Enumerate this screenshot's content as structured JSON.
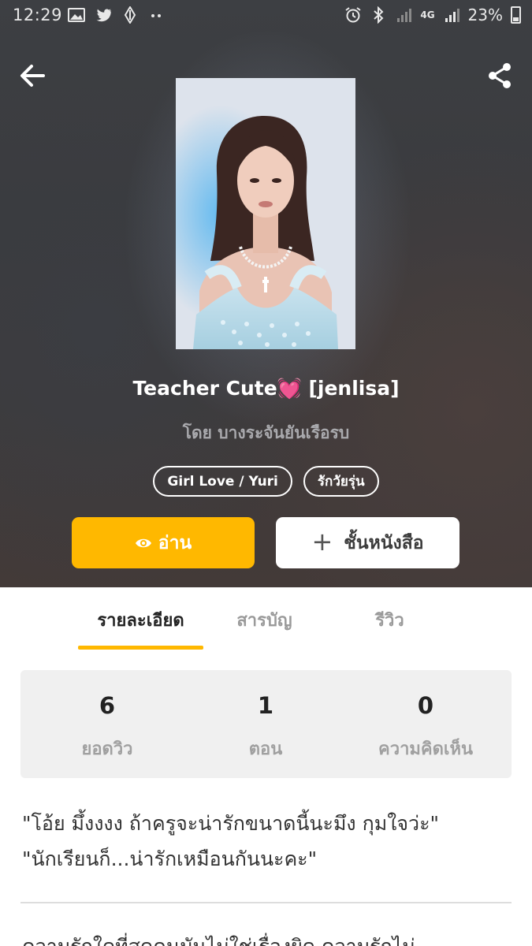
{
  "status_bar": {
    "time": "12:29",
    "network": "4G",
    "battery": "23%"
  },
  "header": {
    "back_icon": "arrow-left-icon",
    "share_icon": "share-icon"
  },
  "book": {
    "title": "Teacher Cute💓 [jenlisa]",
    "author": "โดย บางระจันยันเรือรบ",
    "tags": [
      "Girl Love / Yuri",
      "รักวัยรุ่น"
    ]
  },
  "actions": {
    "read_label": "อ่าน",
    "shelf_label": "ชั้นหนังสือ"
  },
  "tabs": [
    {
      "label": "รายละเอียด",
      "active": true
    },
    {
      "label": "สารบัญ",
      "active": false
    },
    {
      "label": "รีวิว",
      "active": false
    }
  ],
  "stats": [
    {
      "value": "6",
      "label": "ยอดวิว"
    },
    {
      "value": "1",
      "label": "ตอน"
    },
    {
      "value": "0",
      "label": "ความคิดเห็น"
    }
  ],
  "description": {
    "line1": "\"โอ้ย มึ้งงงง ถ้าครูจะน่ารักขนาดนี้นะมึง กุมใจว่ะ\"",
    "line2": "\"นักเรียนก็...น่ารักเหมือนกันนะคะ\"",
    "line3": "ความรักใดที่สุดคนมันไม่ใช่เรื่องผิด ความรักไม่"
  },
  "colors": {
    "accent": "#ffb800",
    "hero_bg": "#3d3f43"
  }
}
